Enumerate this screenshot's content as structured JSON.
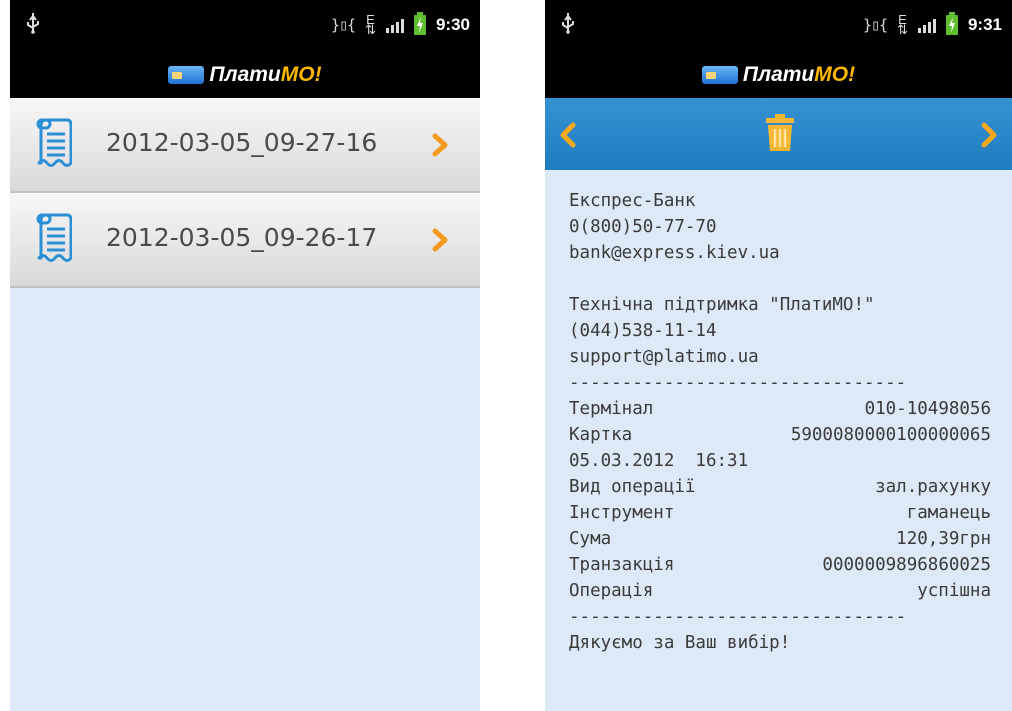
{
  "colors": {
    "accent": "#ffb800",
    "toolbar": "#2a88c9",
    "background": "#dde9f6"
  },
  "logo": {
    "part1": "Плати",
    "part2": "МО!"
  },
  "left_screen": {
    "status_time": "9:30",
    "receipts": [
      {
        "label": "2012-03-05_09-27-16",
        "icon": "receipt-icon"
      },
      {
        "label": "2012-03-05_09-26-17",
        "icon": "receipt-icon"
      }
    ]
  },
  "right_screen": {
    "status_time": "9:31",
    "toolbar": {
      "prev_icon": "chevron-left-icon",
      "delete_icon": "trash-icon",
      "next_icon": "chevron-right-icon"
    },
    "receipt": {
      "bank_name": "Експрес-Банк",
      "bank_phone": "0(800)50-77-70",
      "bank_email": "bank@express.kiev.ua",
      "support_title": "Технічна підтримка \"ПлатиМО!\"",
      "support_phone": "(044)538-11-14",
      "support_email": "support@platimo.ua",
      "separator": "--------------------------------",
      "fields": [
        {
          "label": "Термінал",
          "value": "010-10498056"
        },
        {
          "label": "Картка",
          "value": "5900080000100000065"
        }
      ],
      "datetime": "05.03.2012  16:31",
      "details": [
        {
          "label": "Вид операції",
          "value": "зал.рахунку"
        },
        {
          "label": "Інструмент",
          "value": "гаманець"
        },
        {
          "label": "Сума",
          "value": "120,39грн"
        },
        {
          "label": "Транзакція",
          "value": "0000009896860025"
        },
        {
          "label": "Операція",
          "value": "успішна"
        }
      ],
      "thanks": "Дякуємо за Ваш вибір!"
    }
  }
}
